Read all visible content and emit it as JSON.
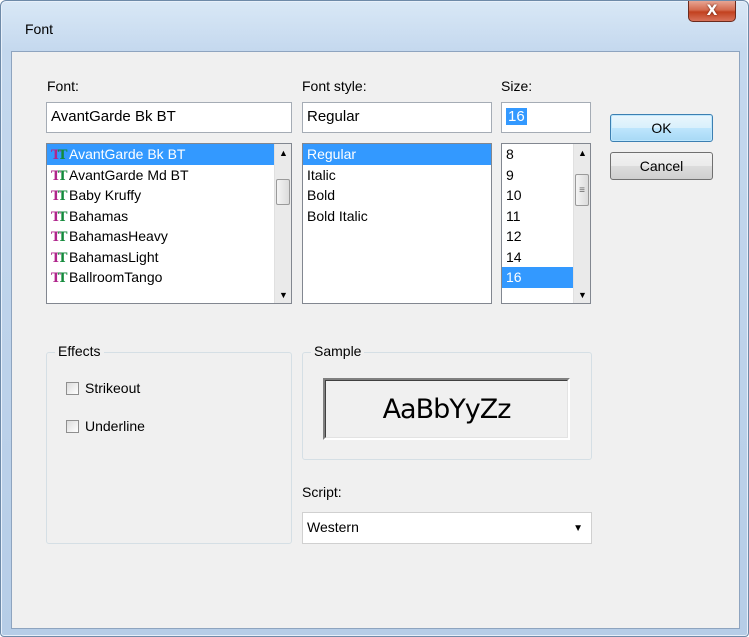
{
  "window": {
    "title": "Font",
    "close_glyph": "X"
  },
  "font": {
    "label": "Font:",
    "value": "AvantGarde Bk BT",
    "items": [
      {
        "label": "AvantGarde Bk BT",
        "selected": true
      },
      {
        "label": "AvantGarde Md BT",
        "selected": false
      },
      {
        "label": "Baby Kruffy",
        "selected": false
      },
      {
        "label": "Bahamas",
        "selected": false
      },
      {
        "label": "BahamasHeavy",
        "selected": false
      },
      {
        "label": "BahamasLight",
        "selected": false
      },
      {
        "label": "BallroomTango",
        "selected": false
      }
    ],
    "item_icon": "truetype-font-icon"
  },
  "style": {
    "label": "Font style:",
    "value": "Regular",
    "items": [
      {
        "label": "Regular",
        "selected": true
      },
      {
        "label": "Italic",
        "selected": false
      },
      {
        "label": "Bold",
        "selected": false
      },
      {
        "label": "Bold Italic",
        "selected": false
      }
    ]
  },
  "size": {
    "label": "Size:",
    "value": "16",
    "items": [
      {
        "label": "8",
        "selected": false
      },
      {
        "label": "9",
        "selected": false
      },
      {
        "label": "10",
        "selected": false
      },
      {
        "label": "11",
        "selected": false
      },
      {
        "label": "12",
        "selected": false
      },
      {
        "label": "14",
        "selected": false
      },
      {
        "label": "16",
        "selected": true
      }
    ]
  },
  "buttons": {
    "ok": "OK",
    "cancel": "Cancel"
  },
  "effects": {
    "title": "Effects",
    "strikeout": {
      "label": "Strikeout",
      "checked": false
    },
    "underline": {
      "label": "Underline",
      "checked": false
    }
  },
  "sample": {
    "title": "Sample",
    "text": "AaBbYyZz"
  },
  "script": {
    "label": "Script:",
    "value": "Western"
  },
  "colors": {
    "selection": "#3399ff",
    "dialog_bg": "#f0f0f0",
    "close_button": "#c2411f"
  }
}
